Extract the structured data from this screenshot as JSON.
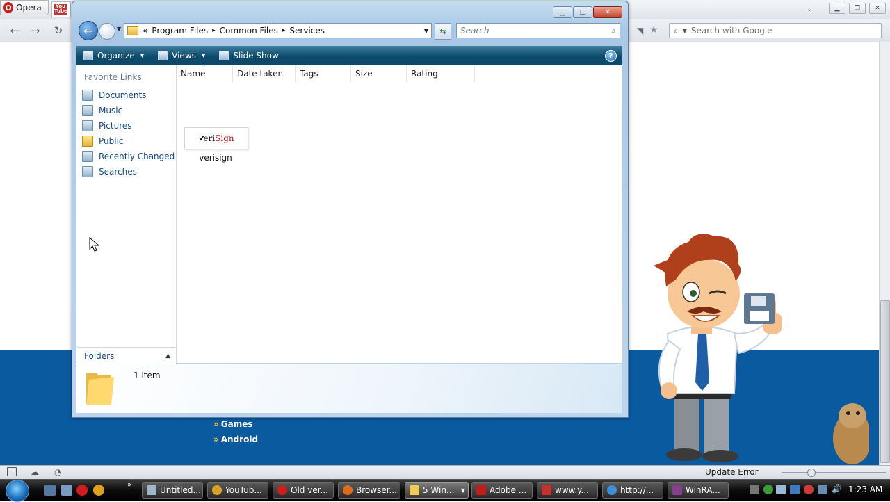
{
  "opera": {
    "menu_label": "Opera",
    "youtube_icon_text": "You Tube",
    "search_placeholder": "Search with Google",
    "status_text": "Update Error"
  },
  "page": {
    "links": [
      "Games",
      "Android"
    ],
    "link_bullet": "»"
  },
  "explorer": {
    "breadcrumb": [
      "Program Files",
      "Common Files",
      "Services"
    ],
    "breadcrumb_prefix": "«",
    "breadcrumb_sep": "▸",
    "search_placeholder": "Search",
    "toolbar": {
      "organize": "Organize",
      "views": "Views",
      "slideshow": "Slide Show"
    },
    "favorite_links_title": "Favorite Links",
    "favorite_links": [
      {
        "label": "Documents",
        "icon": "documents-icon"
      },
      {
        "label": "Music",
        "icon": "music-icon"
      },
      {
        "label": "Pictures",
        "icon": "pictures-icon"
      },
      {
        "label": "Public",
        "icon": "folder-icon"
      },
      {
        "label": "Recently Changed",
        "icon": "recently-changed-icon"
      },
      {
        "label": "Searches",
        "icon": "searches-icon"
      }
    ],
    "folders_label": "Folders",
    "columns": [
      "Name",
      "Date taken",
      "Tags",
      "Size",
      "Rating"
    ],
    "items": [
      {
        "name": "verisign",
        "thumb_text": "VeriSign"
      }
    ],
    "item_count": "1 item"
  },
  "taskbar": {
    "buttons": [
      {
        "label": "Untitled...",
        "color": "#9fb7c9"
      },
      {
        "label": "YouTub...",
        "color": "#d9a321"
      },
      {
        "label": "Old ver...",
        "color": "#d01c1c"
      },
      {
        "label": "Browser...",
        "color": "#e06a1c"
      },
      {
        "label": "5 Win...",
        "color": "#f0cc55"
      },
      {
        "label": "Adobe ...",
        "color": "#c41a1a"
      },
      {
        "label": "www.y...",
        "color": "#c4302b"
      },
      {
        "label": "http://...",
        "color": "#3a8fd6"
      },
      {
        "label": "WinRA...",
        "color": "#8a3d8f"
      }
    ],
    "clock": "1:23 AM"
  }
}
